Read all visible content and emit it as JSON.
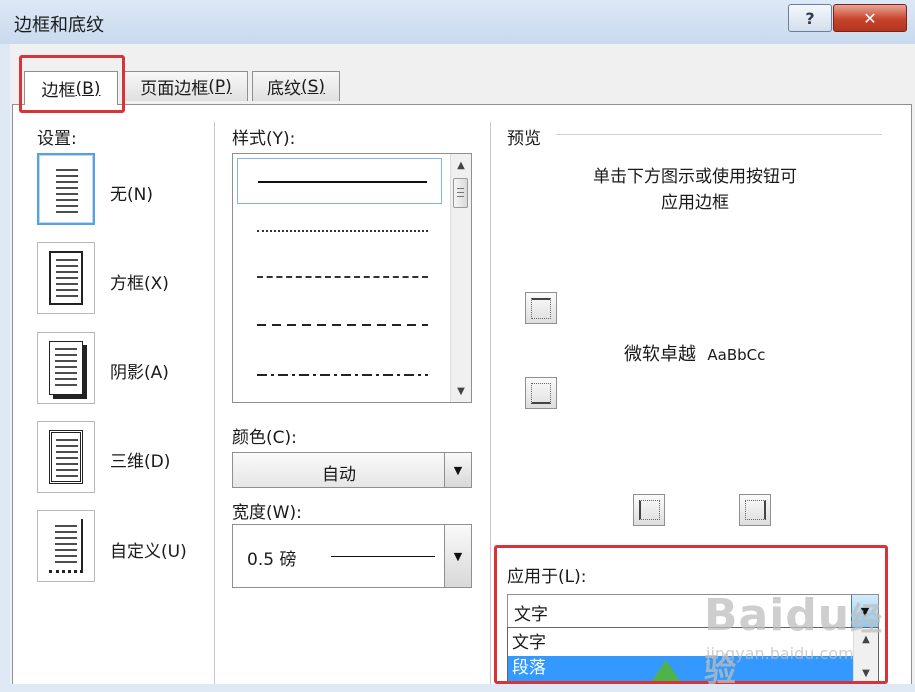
{
  "window": {
    "title": "边框和底纹",
    "help_label": "?",
    "close_label": "✕"
  },
  "tabs": [
    {
      "label": "边框",
      "accel": "(B)",
      "active": true
    },
    {
      "label": "页面边框",
      "accel": "(P)",
      "active": false
    },
    {
      "label": "底纹",
      "accel": "(S)",
      "active": false
    }
  ],
  "settings": {
    "heading": "设置:",
    "items": [
      {
        "label": "无(N)",
        "icon": "page-no-border-icon",
        "selected": true
      },
      {
        "label": "方框(X)",
        "icon": "page-box-border-icon",
        "selected": false
      },
      {
        "label": "阴影(A)",
        "icon": "page-shadow-border-icon",
        "selected": false
      },
      {
        "label": "三维(D)",
        "icon": "page-3d-border-icon",
        "selected": false
      },
      {
        "label": "自定义(U)",
        "icon": "page-custom-border-icon",
        "selected": false
      }
    ]
  },
  "style": {
    "label": "样式(Y):",
    "items": [
      "solid",
      "dotted",
      "dashed-small",
      "dashed",
      "dash-dot"
    ],
    "selected_index": 0
  },
  "color": {
    "label": "颜色(C):",
    "value": "自动"
  },
  "width": {
    "label": "宽度(W):",
    "value": "0.5 磅"
  },
  "preview": {
    "heading": "预览",
    "instruction_line1": "单击下方图示或使用按钮可",
    "instruction_line2": "应用边框",
    "sample_text_cn": "微软卓越",
    "sample_text_en": "AaBbCc"
  },
  "apply_to": {
    "label": "应用于(L):",
    "value": "文字",
    "options": [
      "文字",
      "段落"
    ],
    "highlighted_index": 1
  },
  "watermark": {
    "brand": "Baidu",
    "suffix": "经验",
    "url": "jingyan.baidu.com"
  },
  "colors": {
    "highlight_box": "#d9333a",
    "selection": "#3399ff"
  }
}
